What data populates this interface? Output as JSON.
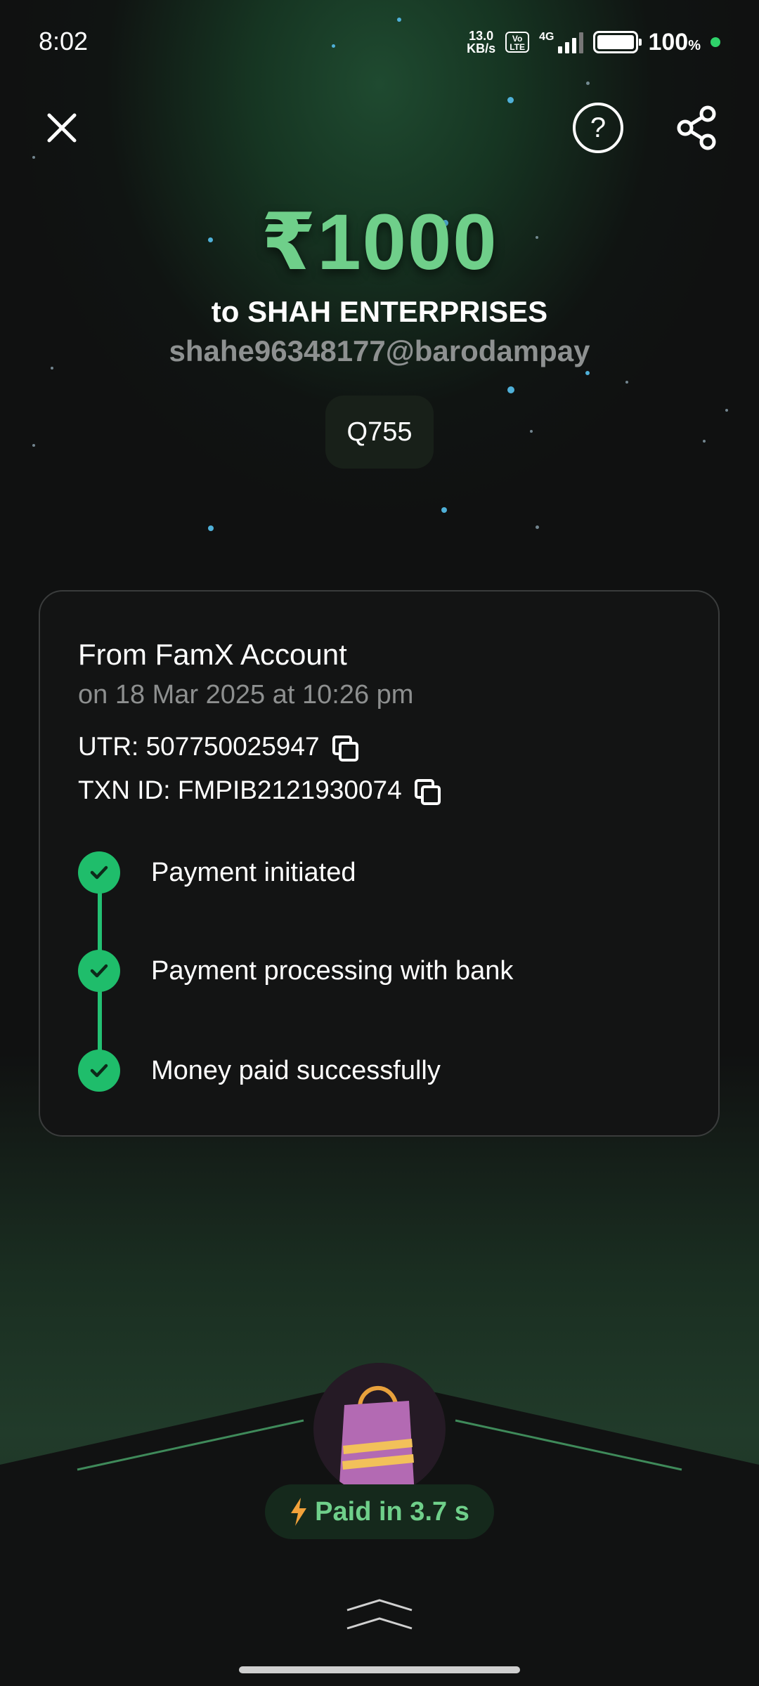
{
  "status_bar": {
    "time": "8:02",
    "net_speed_value": "13.0",
    "net_speed_unit": "KB/s",
    "volte_top": "Vo",
    "volte_bottom": "LTE",
    "network_type": "4G",
    "battery_percent": "100",
    "battery_percent_sign": "%"
  },
  "header": {
    "close_icon": "close-icon",
    "help_label": "?",
    "share_icon": "share-icon"
  },
  "payment": {
    "amount": "₹1000",
    "payee": "to SHAH ENTERPRISES",
    "vpa": "shahe96348177@barodampay",
    "note": "Q755"
  },
  "details": {
    "from": "From FamX Account",
    "date": "on 18 Mar 2025 at 10:26 pm",
    "utr": "UTR: 507750025947",
    "txn_id": "TXN ID: FMPIB2121930074",
    "steps": [
      {
        "label": "Payment initiated"
      },
      {
        "label": "Payment processing with bank"
      },
      {
        "label": "Money paid successfully"
      }
    ]
  },
  "footer": {
    "paid_in": "Paid in 3.7 s",
    "bolt_icon": "bolt-icon",
    "bag_icon": "shopping-bag-icon"
  },
  "colors": {
    "accent_green": "#6fcf8a",
    "check_green": "#1fbd6b",
    "background": "#101111"
  }
}
